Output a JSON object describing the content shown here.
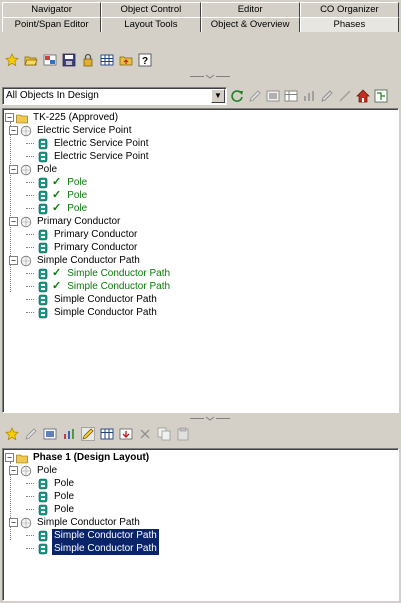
{
  "tabs": {
    "row1": [
      "Navigator",
      "Object Control",
      "Editor",
      "CO Organizer"
    ],
    "row2": [
      "Point/Span Editor",
      "Layout Tools",
      "Object & Overview",
      "Phases"
    ]
  },
  "filter": {
    "selected": "All Objects In Design"
  },
  "top_tree": {
    "root": "TK-225 (Approved)",
    "groups": [
      {
        "label": "Electric Service Point",
        "items": [
          {
            "label": "Electric Service Point",
            "checked": false
          },
          {
            "label": "Electric Service Point",
            "checked": false
          }
        ]
      },
      {
        "label": "Pole",
        "items": [
          {
            "label": "Pole",
            "checked": true
          },
          {
            "label": "Pole",
            "checked": true
          },
          {
            "label": "Pole",
            "checked": true
          }
        ]
      },
      {
        "label": "Primary Conductor",
        "items": [
          {
            "label": "Primary Conductor",
            "checked": false
          },
          {
            "label": "Primary Conductor",
            "checked": false
          }
        ]
      },
      {
        "label": "Simple Conductor Path",
        "items": [
          {
            "label": "Simple Conductor Path",
            "checked": true
          },
          {
            "label": "Simple Conductor Path",
            "checked": true
          },
          {
            "label": "Simple Conductor Path",
            "checked": false
          },
          {
            "label": "Simple Conductor Path",
            "checked": false
          }
        ]
      }
    ]
  },
  "bottom_tree": {
    "root": "Phase 1 (Design Layout)",
    "groups": [
      {
        "label": "Pole",
        "items": [
          {
            "label": "Pole",
            "selected": false
          },
          {
            "label": "Pole",
            "selected": false
          },
          {
            "label": "Pole",
            "selected": false
          }
        ]
      },
      {
        "label": "Simple Conductor Path",
        "items": [
          {
            "label": "Simple Conductor Path",
            "selected": true
          },
          {
            "label": "Simple Conductor Path",
            "selected": true
          }
        ]
      }
    ]
  },
  "icons": {
    "toolbar1": [
      "star-icon",
      "open-folder-icon",
      "grid-color-icon",
      "save-icon",
      "lock-icon",
      "table-icon",
      "folder-up-icon",
      "help-icon"
    ],
    "filter_bar": [
      "refresh-icon",
      "pencil-icon",
      "image-icon",
      "table-icon",
      "chart-icon",
      "pencil-active-icon",
      "ruler-icon",
      "home-icon",
      "network-icon"
    ],
    "toolbar2": [
      "star-icon",
      "pencil-icon",
      "image-icon",
      "chart-icon",
      "pencil-active-icon",
      "table-icon",
      "import-icon",
      "delete-icon",
      "copy-icon",
      "paste-icon"
    ]
  },
  "colors": {
    "checked_text": "#0a7a0a",
    "selection_bg": "#0a246a",
    "panel_bg": "#d4d0c8"
  }
}
